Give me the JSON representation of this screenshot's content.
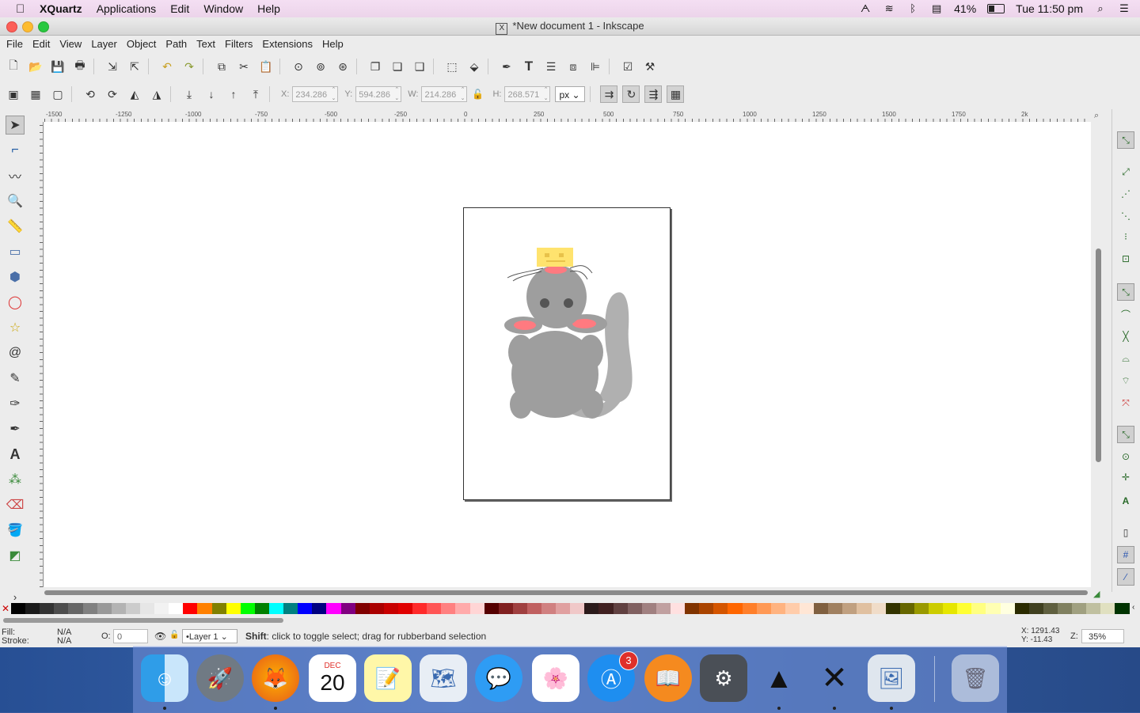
{
  "menubar": {
    "app_name": "XQuartz",
    "items": [
      "Applications",
      "Edit",
      "Window",
      "Help"
    ],
    "battery": "41%",
    "clock": "Tue 11:50 pm"
  },
  "window": {
    "title": "*New document 1 - Inkscape",
    "menu": [
      "File",
      "Edit",
      "View",
      "Layer",
      "Object",
      "Path",
      "Text",
      "Filters",
      "Extensions",
      "Help"
    ]
  },
  "toolcontrols": {
    "x_label": "X:",
    "x_value": "234.286",
    "y_label": "Y:",
    "y_value": "594.286",
    "w_label": "W:",
    "w_value": "214.286",
    "h_label": "H:",
    "h_value": "268.571",
    "unit": "px"
  },
  "ruler": {
    "ticks": [
      "-1500",
      "-1250",
      "-1000",
      "-750",
      "-500",
      "-250",
      "0",
      "250",
      "500",
      "750",
      "1000",
      "1250",
      "1500",
      "1750",
      "2k"
    ]
  },
  "status": {
    "fill_label": "Fill:",
    "fill_value": "N/A",
    "stroke_label": "Stroke:",
    "stroke_value": "N/A",
    "opacity_label": "O:",
    "opacity_value": "0",
    "layer": "•Layer 1",
    "message_bold": "Shift",
    "message": ": click to toggle select; drag for rubberband selection",
    "cursor_x": "X: 1291.43",
    "cursor_y": "Y:  -11.43",
    "zoom_label": "Z:",
    "zoom": "35%"
  },
  "dock": {
    "calendar_month": "DEC",
    "calendar_day": "20",
    "appstore_badge": "3"
  },
  "palette_colors": [
    "#000000",
    "#1a1a1a",
    "#333333",
    "#4d4d4d",
    "#666666",
    "#808080",
    "#999999",
    "#b3b3b3",
    "#cccccc",
    "#e6e6e6",
    "#f2f2f2",
    "#ffffff",
    "#ff0000",
    "#ff8000",
    "#808000",
    "#ffff00",
    "#00ff00",
    "#008000",
    "#00ffff",
    "#008080",
    "#0000ff",
    "#000080",
    "#ff00ff",
    "#800080",
    "#800000",
    "#aa0000",
    "#c80000",
    "#e00000",
    "#ff2a2a",
    "#ff5555",
    "#ff8080",
    "#ffaaaa",
    "#ffd5d5",
    "#550000",
    "#802020",
    "#a04040",
    "#c06060",
    "#d08080",
    "#e0a0a0",
    "#f0c8c8",
    "#2b1a1a",
    "#402020",
    "#604040",
    "#806060",
    "#a08080",
    "#c0a0a0",
    "#ffe0e0",
    "#803300",
    "#aa4400",
    "#d45500",
    "#ff6600",
    "#ff7f2a",
    "#ff9955",
    "#ffb380",
    "#ffccaa",
    "#ffe6d5",
    "#806040",
    "#a08060",
    "#c0a080",
    "#e0c0a0",
    "#f0dcc8",
    "#333300",
    "#666600",
    "#999900",
    "#cccc00",
    "#e6e600",
    "#ffff33",
    "#ffff80",
    "#ffffb3",
    "#ffffe0",
    "#2b2b00",
    "#404020",
    "#606040",
    "#808060",
    "#a0a080",
    "#c0c0a0",
    "#e0e0c0",
    "#003300"
  ]
}
